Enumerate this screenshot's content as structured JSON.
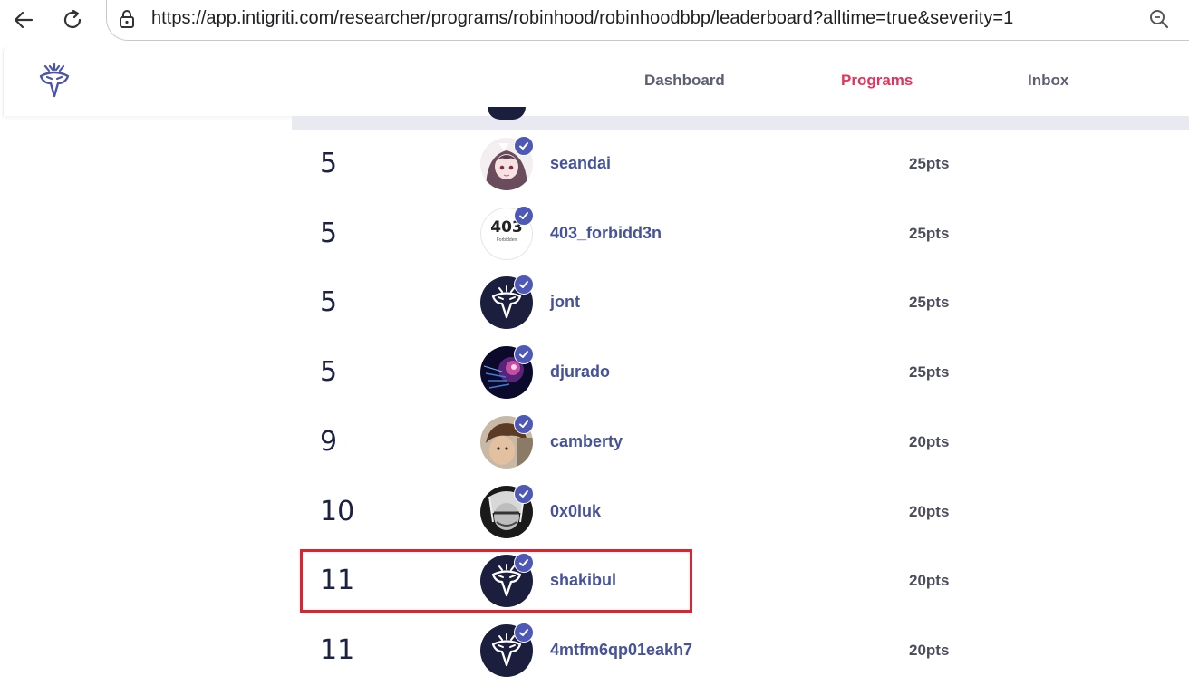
{
  "browser": {
    "url": "https://app.intigriti.com/researcher/programs/robinhood/robinhoodbbp/leaderboard?alltime=true&severity=1",
    "back_icon": "arrow-left-icon",
    "reload_icon": "reload-icon",
    "lock_icon": "lock-icon",
    "zoom_icon": "magnifier-icon"
  },
  "header": {
    "logo": "intigriti-logo-icon",
    "nav": [
      {
        "label": "Dashboard",
        "active": false
      },
      {
        "label": "Programs",
        "active": true
      },
      {
        "label": "Inbox",
        "active": false
      }
    ]
  },
  "colors": {
    "accent": "#e0345d",
    "username": "#465299",
    "verified": "#4e59b5",
    "highlight": "#e0222e",
    "dark_avatar": "#1b1e3d"
  },
  "leaderboard": {
    "rows": [
      {
        "rank": "5",
        "username": "seandai",
        "points": "25pts",
        "avatar": "anime-girl-avatar",
        "verified": true
      },
      {
        "rank": "5",
        "username": "403_forbidd3n",
        "points": "25pts",
        "avatar": "403-text-avatar",
        "verified": true
      },
      {
        "rank": "5",
        "username": "jont",
        "points": "25pts",
        "avatar": "intigriti-default-avatar",
        "verified": true
      },
      {
        "rank": "5",
        "username": "djurado",
        "points": "25pts",
        "avatar": "cyber-head-avatar",
        "verified": true
      },
      {
        "rank": "9",
        "username": "camberty",
        "points": "20pts",
        "avatar": "photo-avatar",
        "verified": true
      },
      {
        "rank": "10",
        "username": "0x0luk",
        "points": "20pts",
        "avatar": "masked-face-avatar",
        "verified": true
      },
      {
        "rank": "11",
        "username": "shakibul",
        "points": "20pts",
        "avatar": "intigriti-default-avatar",
        "verified": true,
        "highlighted": true
      },
      {
        "rank": "11",
        "username": "4mtfm6qp01eakh7",
        "points": "20pts",
        "avatar": "intigriti-default-avatar",
        "verified": true
      }
    ]
  },
  "avatar_403": {
    "big": "403",
    "small": "Forbidden"
  }
}
